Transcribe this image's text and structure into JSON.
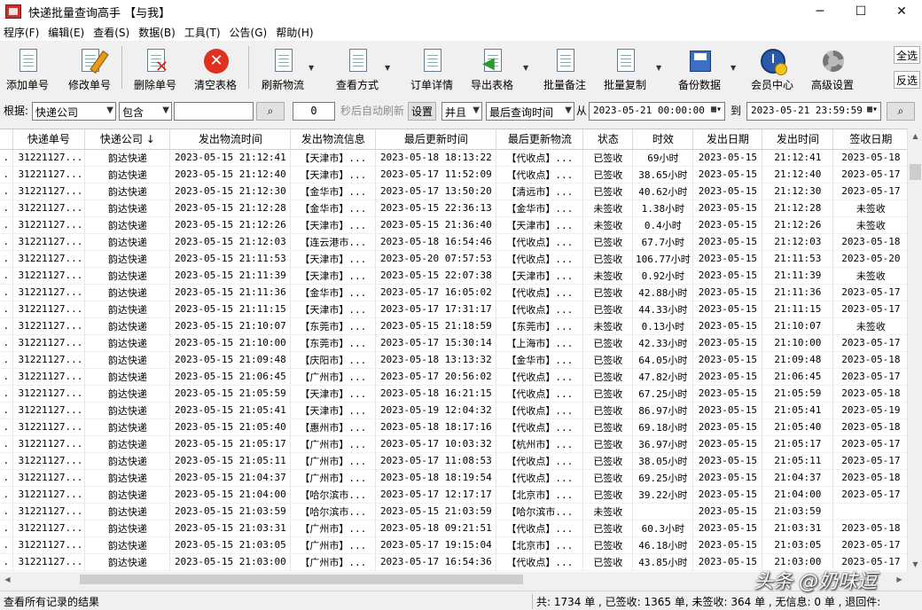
{
  "window": {
    "title": "快递批量查询高手 【与我】",
    "min": "─",
    "max": "☐",
    "close": "✕"
  },
  "menu": [
    "程序(F)",
    "编辑(E)",
    "查看(S)",
    "数据(B)",
    "工具(T)",
    "公告(G)",
    "帮助(H)"
  ],
  "toolbar": {
    "add": "添加单号",
    "edit": "修改单号",
    "delete": "删除单号",
    "clear": "清空表格",
    "refresh": "刷新物流",
    "view_mode": "查看方式",
    "order_detail": "订单详情",
    "export": "导出表格",
    "batch_note": "批量备注",
    "batch_copy": "批量复制",
    "backup": "备份数据",
    "member": "会员中心",
    "advanced": "高级设置",
    "select_all": "全选",
    "invert": "反选"
  },
  "filter": {
    "by_label": "根据:",
    "field": "快递公司",
    "match": "包含",
    "keyword": "",
    "interval": "0",
    "interval_hint": "秒后自动刷新",
    "set_button": "设置",
    "logic": "并且",
    "time_field": "最后查询时间",
    "from_label": "从",
    "from": "2023-05-21 00:00:00",
    "to_label": "到",
    "to": "2023-05-21 23:59:59"
  },
  "columns": [
    "快递单号",
    "快递公司 ↓",
    "发出物流时间",
    "发出物流信息",
    "最后更新时间",
    "最后更新物流",
    "状态",
    "时效",
    "发出日期",
    "发出时间",
    "签收日期"
  ],
  "rows": [
    [
      "31221127...",
      "韵达快递",
      "2023-05-15 21:12:41",
      "【天津市】...",
      "2023-05-18 18:13:22",
      "【代收点】...",
      "已签收",
      "69小时",
      "2023-05-15",
      "21:12:41",
      "2023-05-18"
    ],
    [
      "31221127...",
      "韵达快递",
      "2023-05-15 21:12:40",
      "【天津市】...",
      "2023-05-17 11:52:09",
      "【代收点】...",
      "已签收",
      "38.65小时",
      "2023-05-15",
      "21:12:40",
      "2023-05-17"
    ],
    [
      "31221127...",
      "韵达快递",
      "2023-05-15 21:12:30",
      "【金华市】...",
      "2023-05-17 13:50:20",
      "【清远市】...",
      "已签收",
      "40.62小时",
      "2023-05-15",
      "21:12:30",
      "2023-05-17"
    ],
    [
      "31221127...",
      "韵达快递",
      "2023-05-15 21:12:28",
      "【金华市】...",
      "2023-05-15 22:36:13",
      "【金华市】...",
      "未签收",
      "1.38小时",
      "2023-05-15",
      "21:12:28",
      "未签收"
    ],
    [
      "31221127...",
      "韵达快递",
      "2023-05-15 21:12:26",
      "【天津市】...",
      "2023-05-15 21:36:40",
      "【天津市】...",
      "未签收",
      "0.4小时",
      "2023-05-15",
      "21:12:26",
      "未签收"
    ],
    [
      "31221127...",
      "韵达快递",
      "2023-05-15 21:12:03",
      "【连云港市...",
      "2023-05-18 16:54:46",
      "【代收点】...",
      "已签收",
      "67.7小时",
      "2023-05-15",
      "21:12:03",
      "2023-05-18"
    ],
    [
      "31221127...",
      "韵达快递",
      "2023-05-15 21:11:53",
      "【天津市】...",
      "2023-05-20 07:57:53",
      "【代收点】...",
      "已签收",
      "106.77小时",
      "2023-05-15",
      "21:11:53",
      "2023-05-20"
    ],
    [
      "31221127...",
      "韵达快递",
      "2023-05-15 21:11:39",
      "【天津市】...",
      "2023-05-15 22:07:38",
      "【天津市】...",
      "未签收",
      "0.92小时",
      "2023-05-15",
      "21:11:39",
      "未签收"
    ],
    [
      "31221127...",
      "韵达快递",
      "2023-05-15 21:11:36",
      "【金华市】...",
      "2023-05-17 16:05:02",
      "【代收点】...",
      "已签收",
      "42.88小时",
      "2023-05-15",
      "21:11:36",
      "2023-05-17"
    ],
    [
      "31221127...",
      "韵达快递",
      "2023-05-15 21:11:15",
      "【天津市】...",
      "2023-05-17 17:31:17",
      "【代收点】...",
      "已签收",
      "44.33小时",
      "2023-05-15",
      "21:11:15",
      "2023-05-17"
    ],
    [
      "31221127...",
      "韵达快递",
      "2023-05-15 21:10:07",
      "【东莞市】...",
      "2023-05-15 21:18:59",
      "【东莞市】...",
      "未签收",
      "0.13小时",
      "2023-05-15",
      "21:10:07",
      "未签收"
    ],
    [
      "31221127...",
      "韵达快递",
      "2023-05-15 21:10:00",
      "【东莞市】...",
      "2023-05-17 15:30:14",
      "【上海市】...",
      "已签收",
      "42.33小时",
      "2023-05-15",
      "21:10:00",
      "2023-05-17"
    ],
    [
      "31221127...",
      "韵达快递",
      "2023-05-15 21:09:48",
      "【庆阳市】...",
      "2023-05-18 13:13:32",
      "【金华市】...",
      "已签收",
      "64.05小时",
      "2023-05-15",
      "21:09:48",
      "2023-05-18"
    ],
    [
      "31221127...",
      "韵达快递",
      "2023-05-15 21:06:45",
      "【广州市】...",
      "2023-05-17 20:56:02",
      "【代收点】...",
      "已签收",
      "47.82小时",
      "2023-05-15",
      "21:06:45",
      "2023-05-17"
    ],
    [
      "31221127...",
      "韵达快递",
      "2023-05-15 21:05:59",
      "【天津市】...",
      "2023-05-18 16:21:15",
      "【代收点】...",
      "已签收",
      "67.25小时",
      "2023-05-15",
      "21:05:59",
      "2023-05-18"
    ],
    [
      "31221127...",
      "韵达快递",
      "2023-05-15 21:05:41",
      "【天津市】...",
      "2023-05-19 12:04:32",
      "【代收点】...",
      "已签收",
      "86.97小时",
      "2023-05-15",
      "21:05:41",
      "2023-05-19"
    ],
    [
      "31221127...",
      "韵达快递",
      "2023-05-15 21:05:40",
      "【惠州市】...",
      "2023-05-18 18:17:16",
      "【代收点】...",
      "已签收",
      "69.18小时",
      "2023-05-15",
      "21:05:40",
      "2023-05-18"
    ],
    [
      "31221127...",
      "韵达快递",
      "2023-05-15 21:05:17",
      "【广州市】...",
      "2023-05-17 10:03:32",
      "【杭州市】...",
      "已签收",
      "36.97小时",
      "2023-05-15",
      "21:05:17",
      "2023-05-17"
    ],
    [
      "31221127...",
      "韵达快递",
      "2023-05-15 21:05:11",
      "【广州市】...",
      "2023-05-17 11:08:53",
      "【代收点】...",
      "已签收",
      "38.05小时",
      "2023-05-15",
      "21:05:11",
      "2023-05-17"
    ],
    [
      "31221127...",
      "韵达快递",
      "2023-05-15 21:04:37",
      "【广州市】...",
      "2023-05-18 18:19:54",
      "【代收点】...",
      "已签收",
      "69.25小时",
      "2023-05-15",
      "21:04:37",
      "2023-05-18"
    ],
    [
      "31221127...",
      "韵达快递",
      "2023-05-15 21:04:00",
      "【哈尔滨市...",
      "2023-05-17 12:17:17",
      "【北京市】...",
      "已签收",
      "39.22小时",
      "2023-05-15",
      "21:04:00",
      "2023-05-17"
    ],
    [
      "31221127...",
      "韵达快递",
      "2023-05-15 21:03:59",
      "【哈尔滨市...",
      "2023-05-15 21:03:59",
      "【哈尔滨市...",
      "未签收",
      "",
      "2023-05-15",
      "21:03:59",
      ""
    ],
    [
      "31221127...",
      "韵达快递",
      "2023-05-15 21:03:31",
      "【广州市】...",
      "2023-05-18 09:21:51",
      "【代收点】...",
      "已签收",
      "60.3小时",
      "2023-05-15",
      "21:03:31",
      "2023-05-18"
    ],
    [
      "31221127...",
      "韵达快递",
      "2023-05-15 21:03:05",
      "【广州市】...",
      "2023-05-17 19:15:04",
      "【北京市】...",
      "已签收",
      "46.18小时",
      "2023-05-15",
      "21:03:05",
      "2023-05-17"
    ],
    [
      "31221127...",
      "韵达快递",
      "2023-05-15 21:03:00",
      "【广州市】...",
      "2023-05-17 16:54:36",
      "【代收点】...",
      "已签收",
      "43.85小时",
      "2023-05-15",
      "21:03:00",
      "2023-05-17"
    ]
  ],
  "status": {
    "left": "查看所有记录的结果",
    "right": "共: 1734 单 , 已签收: 1365 单, 未签收: 364 单 , 无信息: 0 单 , 退回件:"
  },
  "watermark": "头条 @奶味逗"
}
